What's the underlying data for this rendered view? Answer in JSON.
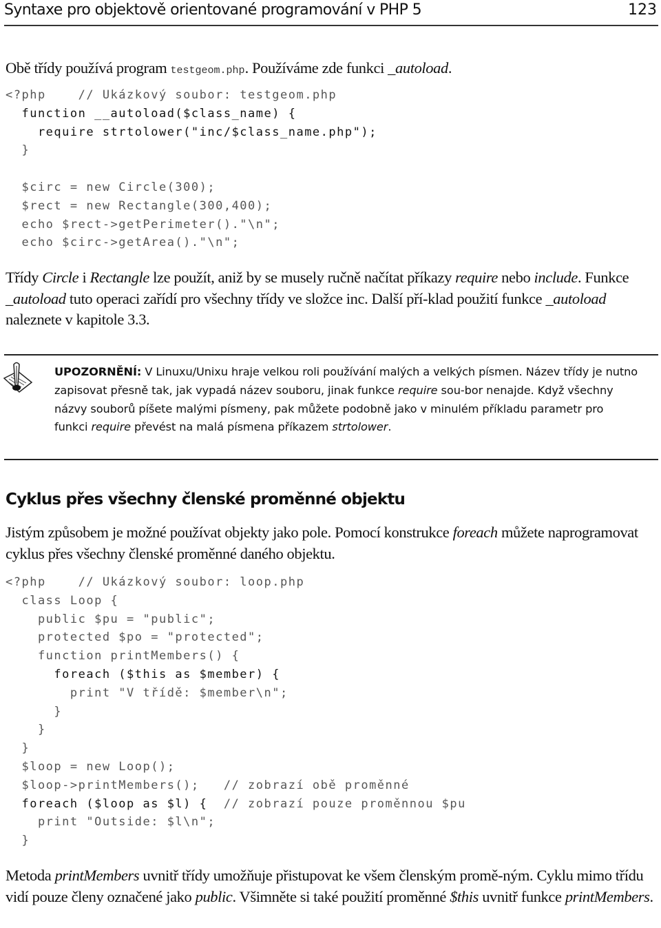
{
  "header": {
    "title": "Syntaxe pro objektově orientované programování v PHP 5",
    "page_number": "123"
  },
  "intro": {
    "text_before": "Obě třídy používá program ",
    "filename": "testgeom.php",
    "text_middle": ". Používáme zde funkci ",
    "function_name": "_autoload",
    "text_after": "."
  },
  "code1": {
    "lines": [
      {
        "text": "<?php    // Ukázkový soubor: testgeom.php",
        "strong": false
      },
      {
        "text": "  function __autoload($class_name) {",
        "strong": true
      },
      {
        "text": "    require strtolower(\"inc/$class_name.php\");",
        "strong": true
      },
      {
        "text": "  }",
        "strong": false
      },
      {
        "text": "",
        "strong": false
      },
      {
        "text": "  $circ = new Circle(300);",
        "strong": false
      },
      {
        "text": "  $rect = new Rectangle(300,400);",
        "strong": false
      },
      {
        "text": "  echo $rect->getPerimeter().\"\\n\";",
        "strong": false
      },
      {
        "text": "  echo $circ->getArea().\"\\n\";",
        "strong": false
      }
    ]
  },
  "para1": {
    "s1": "Třídy ",
    "i1": "Circle",
    "s2": " i ",
    "i2": "Rectangle",
    "s3": " lze použít, aniž by se musely ručně načítat příkazy ",
    "i3": "require",
    "s4": " nebo ",
    "i4": "include",
    "s5": ". Funkce ",
    "i5": "_autoload",
    "s6": " tuto operaci zařídí pro všechny třídy ve složce inc. Další pří-klad použití funkce ",
    "i6": "_autoload",
    "s7": " naleznete v kapitole 3.3."
  },
  "note": {
    "icon": "quill-note-icon",
    "label": "UPOZORNĚNÍ:",
    "s1": " V Linuxu/Unixu hraje velkou roli používání malých a velkých písmen. Název třídy je nutno zapisovat přesně tak, jak vypadá název souboru, jinak funkce ",
    "i1": "require",
    "s2": " sou-bor nenajde. Když všechny názvy souborů píšete malými písmeny, pak můžete podobně jako v minulém příkladu parametr pro funkci ",
    "i2": "require",
    "s3": " převést na malá písmena příkazem ",
    "i3": "strtolower",
    "s4": "."
  },
  "section": {
    "title": "Cyklus přes všechny členské proměnné objektu"
  },
  "para2": {
    "s1": "Jistým způsobem je možné používat objekty jako pole. Pomocí konstrukce ",
    "i1": "foreach",
    "s2": " můžete naprogramovat cyklus přes všechny členské proměnné daného objektu."
  },
  "code2": {
    "lines": [
      {
        "text": "<?php    // Ukázkový soubor: loop.php",
        "strong": false
      },
      {
        "text": "  class Loop {",
        "strong": false
      },
      {
        "text": "    public $pu = \"public\";",
        "strong": false
      },
      {
        "text": "    protected $po = \"protected\";",
        "strong": false
      },
      {
        "text": "    function printMembers() {",
        "strong": false
      },
      {
        "text": "      foreach ($this as $member) {",
        "strong": true
      },
      {
        "text": "        print \"V třídě: $member\\n\";",
        "strong": false
      },
      {
        "text": "      }",
        "strong": false
      },
      {
        "text": "    }",
        "strong": false
      },
      {
        "text": "  }",
        "strong": false
      },
      {
        "text": "  $loop = new Loop();",
        "strong": false
      },
      {
        "text": "  $loop->printMembers();   // zobrazí obě proměnné",
        "strong": false
      },
      {
        "text": "  foreach ($loop as $l) {  // zobrazí pouze proměnnou $pu",
        "strong": "partial"
      },
      {
        "text": "    print \"Outside: $l\\n\";",
        "strong": false
      },
      {
        "text": "  }",
        "strong": false
      }
    ]
  },
  "para3": {
    "s1": "Metoda ",
    "i1": "printMembers",
    "s2": " uvnitř třídy umožňuje přistupovat ke všem členským promě-ným. Cyklu mimo třídu vidí pouze členy označené jako ",
    "i2": "public",
    "s3": ". Všimněte si také použití proměnné ",
    "i3": "$this",
    "s4": " uvnitř funkce ",
    "i4": "printMembers",
    "s5": "."
  }
}
